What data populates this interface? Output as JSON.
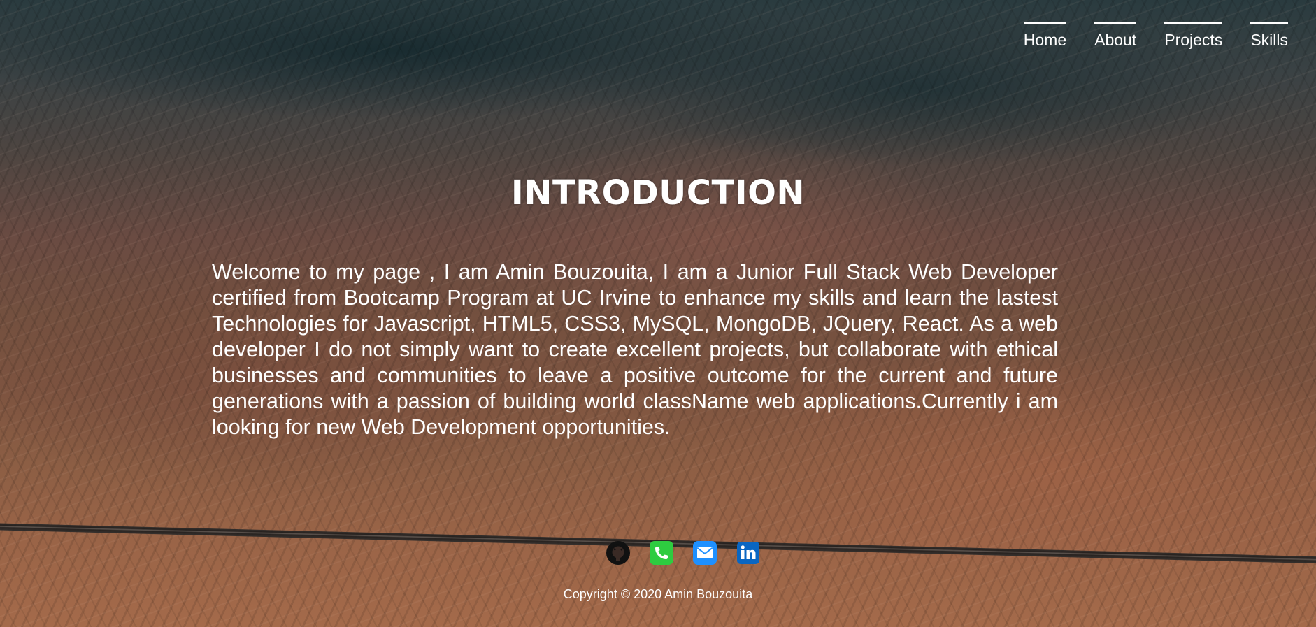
{
  "nav": {
    "items": [
      {
        "label": "Home"
      },
      {
        "label": "About"
      },
      {
        "label": "Projects"
      },
      {
        "label": "Skills"
      }
    ]
  },
  "main": {
    "title": "INTRODUCTION",
    "intro": "Welcome to my page , I am Amin Bouzouita, I am a Junior Full Stack Web Developer certified from Bootcamp Program at UC Irvine to enhance my skills and learn the lastest Technologies for Javascript, HTML5, CSS3, MySQL, MongoDB, JQuery, React. As a web developer I do not simply want to create excellent projects, but collaborate with ethical businesses and communities to leave a positive outcome for the current and future generations with a passion of building world className web applications.Currently i am looking for new Web Development opportunities."
  },
  "footer": {
    "social": [
      {
        "icon": "github-icon"
      },
      {
        "icon": "phone-icon"
      },
      {
        "icon": "email-icon"
      },
      {
        "icon": "linkedin-icon"
      }
    ],
    "copyright": "Copyright © 2020 Amin Bouzouita"
  },
  "colors": {
    "text": "#ffffff",
    "phone": "#2ecc40",
    "email": "#1e90ff",
    "linkedin": "#0a66c2"
  }
}
